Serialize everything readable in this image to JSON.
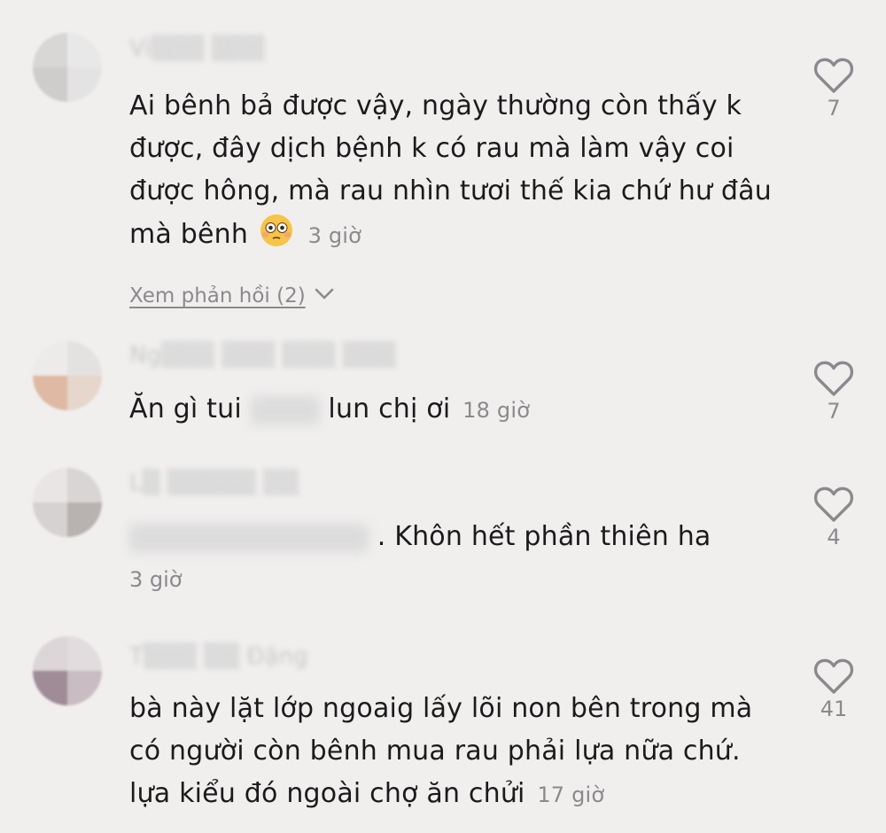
{
  "comments": [
    {
      "username": "Vi▒▒▒ ▒▒▒",
      "text": "Ai bênh bả được vậy, ngày thường còn thấy k được, đây dịch bệnh k có rau mà làm vậy coi được hông, mà rau nhìn tươi thế kia chứ hư đâu mà bênh",
      "emoji": "flushed-face",
      "time": "3 giờ",
      "likes": "7",
      "replies_label": "Xem phản hồi (2)"
    },
    {
      "username": "Ng▒▒▒ ▒▒▒ ▒▒▒ ▒▒▒",
      "text_before": "Ăn gì tui",
      "text_after": "lun chị ơi",
      "time": "18 giờ",
      "likes": "7"
    },
    {
      "username": "L▒ ▒▒▒▒▒ ▒▒",
      "text": ". Khôn hết phần thiên ha",
      "time": "3 giờ",
      "likes": "4"
    },
    {
      "username": "T▒▒▒ ▒▒ Đặng",
      "text": "bà này lặt lớp ngoaig lấy lõi non bên trong mà có người còn bênh mua rau phải lựa nữa chứ. lựa kiểu đó ngoài chợ ăn chửi",
      "time": "17 giờ",
      "likes": "41"
    }
  ],
  "icons": {
    "like": "heart-outline-icon",
    "expand": "chevron-down-icon"
  },
  "colors": {
    "background": "#f0efee",
    "text": "#1b1b1d",
    "muted": "#8a8a8e"
  }
}
